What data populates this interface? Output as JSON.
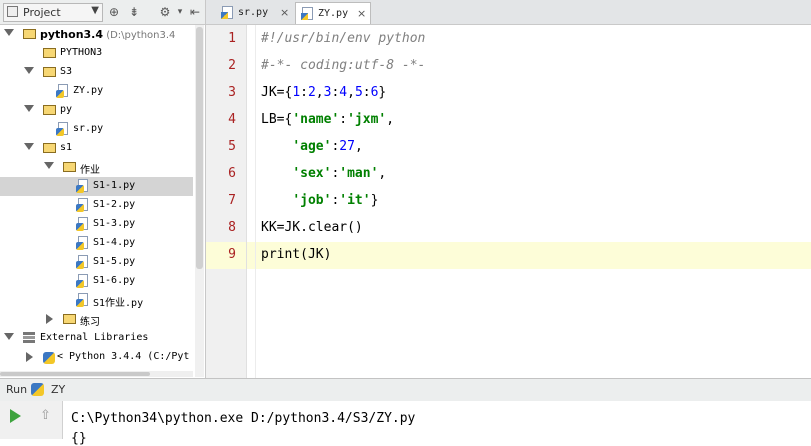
{
  "project_panel": {
    "dropdown_label": "Project",
    "tree": [
      {
        "label": "python3.4",
        "hint": "(D:\\python3.4",
        "kind": "folder",
        "depth": 0,
        "expanded": true,
        "bold": true
      },
      {
        "label": "PYTHON3",
        "kind": "folder",
        "depth": 1,
        "expanded": null
      },
      {
        "label": "S3",
        "kind": "folder",
        "depth": 1,
        "expanded": true
      },
      {
        "label": "ZY.py",
        "kind": "file",
        "depth": 2
      },
      {
        "label": "py",
        "kind": "folder",
        "depth": 1,
        "expanded": true
      },
      {
        "label": "sr.py",
        "kind": "file",
        "depth": 2
      },
      {
        "label": "s1",
        "kind": "folder",
        "depth": 1,
        "expanded": true
      },
      {
        "label": "作业",
        "kind": "folder",
        "depth": 2,
        "expanded": true
      },
      {
        "label": "S1-1.py",
        "kind": "file",
        "depth": 3,
        "selected": true
      },
      {
        "label": "S1-2.py",
        "kind": "file",
        "depth": 3
      },
      {
        "label": "S1-3.py",
        "kind": "file",
        "depth": 3
      },
      {
        "label": "S1-4.py",
        "kind": "file",
        "depth": 3
      },
      {
        "label": "S1-5.py",
        "kind": "file",
        "depth": 3
      },
      {
        "label": "S1-6.py",
        "kind": "file",
        "depth": 3
      },
      {
        "label": "S1作业.py",
        "kind": "file",
        "depth": 3
      },
      {
        "label": "练习",
        "kind": "folder",
        "depth": 2,
        "expanded": false
      },
      {
        "label": "External Libraries",
        "kind": "library",
        "depth": 0,
        "expanded": true
      },
      {
        "label": "< Python 3.4.4 (C:/Pyt",
        "kind": "python-sdk",
        "depth": 1,
        "expanded": false
      }
    ]
  },
  "editor": {
    "tabs": [
      {
        "label": "sr.py",
        "close": "×",
        "active": false
      },
      {
        "label": "ZY.py",
        "close": "×",
        "active": true
      }
    ],
    "current_line": 9,
    "lines": [
      {
        "n": "1",
        "tokens": [
          {
            "t": "#!/usr/bin/env python",
            "c": "cmt"
          }
        ]
      },
      {
        "n": "2",
        "tokens": [
          {
            "t": "#-*- coding:utf-8 -*-",
            "c": "cmt"
          }
        ]
      },
      {
        "n": "3",
        "tokens": [
          {
            "t": "JK={",
            "c": ""
          },
          {
            "t": "1",
            "c": "num"
          },
          {
            "t": ":",
            "c": ""
          },
          {
            "t": "2",
            "c": "num"
          },
          {
            "t": ",",
            "c": ""
          },
          {
            "t": "3",
            "c": "num"
          },
          {
            "t": ":",
            "c": ""
          },
          {
            "t": "4",
            "c": "num"
          },
          {
            "t": ",",
            "c": ""
          },
          {
            "t": "5",
            "c": "num"
          },
          {
            "t": ":",
            "c": ""
          },
          {
            "t": "6",
            "c": "num"
          },
          {
            "t": "}",
            "c": ""
          }
        ]
      },
      {
        "n": "4",
        "tokens": [
          {
            "t": "LB={",
            "c": ""
          },
          {
            "t": "'name'",
            "c": "str"
          },
          {
            "t": ":",
            "c": ""
          },
          {
            "t": "'jxm'",
            "c": "str"
          },
          {
            "t": ",",
            "c": ""
          }
        ]
      },
      {
        "n": "5",
        "tokens": [
          {
            "t": "    ",
            "c": ""
          },
          {
            "t": "'age'",
            "c": "str"
          },
          {
            "t": ":",
            "c": ""
          },
          {
            "t": "27",
            "c": "num"
          },
          {
            "t": ",",
            "c": ""
          }
        ]
      },
      {
        "n": "6",
        "tokens": [
          {
            "t": "    ",
            "c": ""
          },
          {
            "t": "'sex'",
            "c": "str"
          },
          {
            "t": ":",
            "c": ""
          },
          {
            "t": "'man'",
            "c": "str"
          },
          {
            "t": ",",
            "c": ""
          }
        ]
      },
      {
        "n": "7",
        "tokens": [
          {
            "t": "    ",
            "c": ""
          },
          {
            "t": "'job'",
            "c": "str"
          },
          {
            "t": ":",
            "c": ""
          },
          {
            "t": "'it'",
            "c": "str"
          },
          {
            "t": "}",
            "c": ""
          }
        ]
      },
      {
        "n": "8",
        "tokens": [
          {
            "t": "KK=JK.clear()",
            "c": ""
          }
        ]
      },
      {
        "n": "9",
        "tokens": [
          {
            "t": "print(JK)",
            "c": ""
          }
        ]
      }
    ]
  },
  "run_panel": {
    "label": "Run",
    "config_name": "ZY",
    "output_line": "C:\\Python34\\python.exe D:/python3.4/S3/ZY.py",
    "output_line2": "{}"
  },
  "colors": {
    "selection_row": "#d4d4d4",
    "current_line": "#fdfdd8",
    "line_numbers": "#aa2222",
    "string": "#008000",
    "number": "#0000ff",
    "comment": "#808080"
  }
}
